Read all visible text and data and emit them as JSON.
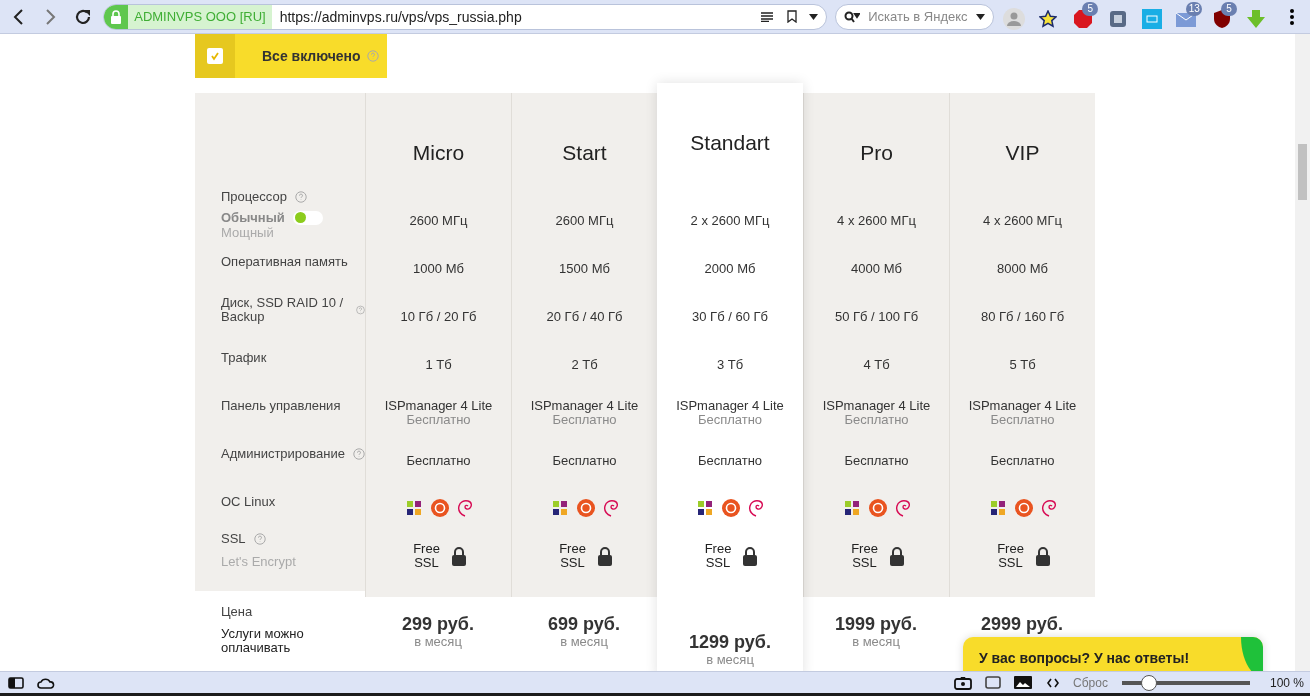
{
  "browser": {
    "site_badge": "ADMINVPS OOO [RU]",
    "url": "https://adminvps.ru/vps/vps_russia.php",
    "search": {
      "placeholder": "Искать в Яндекс"
    },
    "extensions": [
      {
        "kind": "avatar"
      },
      {
        "kind": "star"
      },
      {
        "kind": "stop",
        "badge": "5"
      },
      {
        "kind": "puzzle"
      },
      {
        "kind": "tile"
      },
      {
        "kind": "mail",
        "badge": "13"
      },
      {
        "kind": "shield",
        "badge": "5"
      },
      {
        "kind": "download"
      }
    ]
  },
  "included": {
    "label": "Все включено",
    "checked": true
  },
  "rows": [
    {
      "kind": "processor",
      "label": "Процессор",
      "help": true,
      "modes": [
        {
          "label": "Обычный",
          "selected": true
        },
        {
          "label": "Мощный",
          "selected": false
        }
      ]
    },
    {
      "kind": "text",
      "label": "Оперативная память",
      "help": false
    },
    {
      "kind": "text",
      "label": "Диск, SSD RAID 10 / Backup",
      "help": true
    },
    {
      "kind": "text",
      "label": "Трафик",
      "help": false
    },
    {
      "kind": "panel",
      "label": "Панель управления",
      "help": false
    },
    {
      "kind": "text",
      "label": "Администрирование",
      "help": true
    },
    {
      "kind": "os",
      "label": "ОС Linux",
      "help": false
    },
    {
      "kind": "ssl",
      "label": "SSL",
      "help": true,
      "sublabel": "Let's Encrypt"
    }
  ],
  "plans": [
    {
      "name": "Micro",
      "highlighted": false,
      "cells": [
        "2600 МГц",
        "1000 Мб",
        "10 Гб / 20 Гб",
        "1 Тб",
        {
          "value": "ISPmanager 4 Lite",
          "note": "Бесплатно"
        },
        "Бесплатно",
        "",
        "Free SSL"
      ],
      "price": "299 руб.",
      "period": "в месяц"
    },
    {
      "name": "Start",
      "highlighted": false,
      "cells": [
        "2600 МГц",
        "1500 Мб",
        "20 Гб / 40 Гб",
        "2 Тб",
        {
          "value": "ISPmanager 4 Lite",
          "note": "Бесплатно"
        },
        "Бесплатно",
        "",
        "Free SSL"
      ],
      "price": "699 руб.",
      "period": "в месяц"
    },
    {
      "name": "Standart",
      "highlighted": true,
      "cells": [
        "2 x 2600 МГц",
        "2000 Мб",
        "30 Гб / 60 Гб",
        "3 Тб",
        {
          "value": "ISPmanager 4 Lite",
          "note": "Бесплатно"
        },
        "Бесплатно",
        "",
        "Free SSL"
      ],
      "price": "1299 руб.",
      "period": "в месяц"
    },
    {
      "name": "Pro",
      "highlighted": false,
      "cells": [
        "4 x 2600 МГц",
        "4000 Мб",
        "50 Гб / 100 Гб",
        "4 Тб",
        {
          "value": "ISPmanager 4 Lite",
          "note": "Бесплатно"
        },
        "Бесплатно",
        "",
        "Free SSL"
      ],
      "price": "1999 руб.",
      "period": "в месяц"
    },
    {
      "name": "VIP",
      "highlighted": false,
      "cells": [
        "4 x 2600 МГц",
        "8000 Мб",
        "80 Гб / 160 Гб",
        "5 Тб",
        {
          "value": "ISPmanager 4 Lite",
          "note": "Бесплатно"
        },
        "Бесплатно",
        "",
        "Free SSL"
      ],
      "price": "2999 руб."
    }
  ],
  "price_row": {
    "label": "Цена",
    "note": "Услуги можно оплачивать"
  },
  "chat": {
    "text": "У вас вопросы? У нас ответы!"
  },
  "status_bar": {
    "reset": "Сброс",
    "zoom": {
      "level": 0.2
    },
    "zoom_reading": "100 %"
  }
}
